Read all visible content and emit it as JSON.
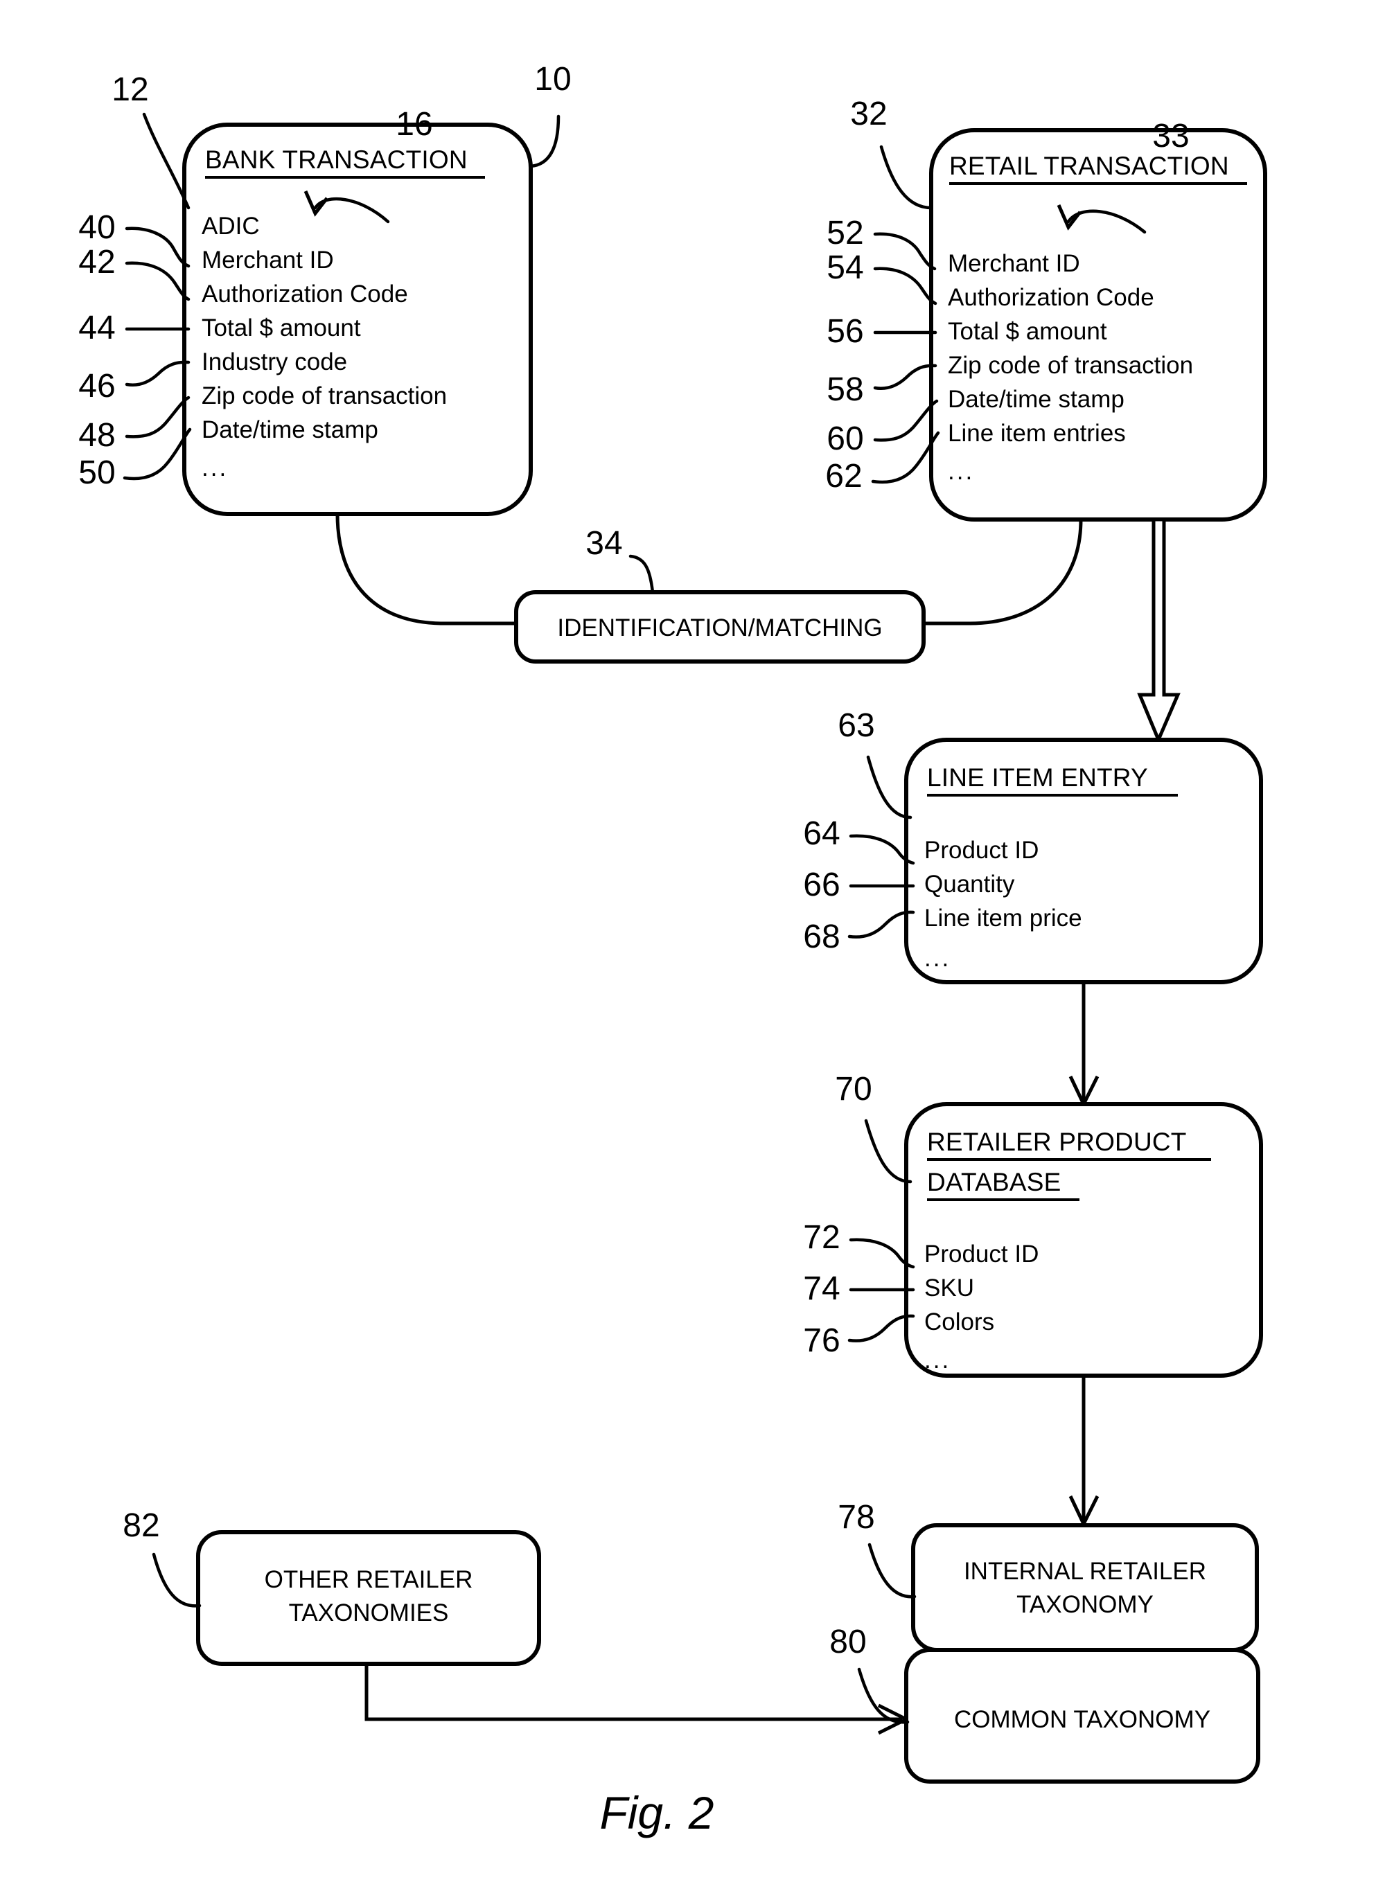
{
  "figure": {
    "caption": "Fig. 2"
  },
  "boxes": {
    "bank_transaction": {
      "ref": "10",
      "title_ref": "12",
      "arrow_ref": "16",
      "title": "BANK TRANSACTION",
      "fields": [
        {
          "ref": "40",
          "label": "ADIC"
        },
        {
          "ref": "42",
          "label": "Merchant ID"
        },
        {
          "ref": "44",
          "label": "Authorization Code"
        },
        {
          "ref": "46",
          "label": "Total $ amount"
        },
        {
          "ref": "48",
          "label": "Industry code"
        },
        {
          "ref": "50",
          "label": "Zip code of transaction"
        },
        {
          "ref": "",
          "label": "Date/time stamp"
        },
        {
          "ref": "",
          "label": "..."
        }
      ],
      "field_refs": [
        "40",
        "42",
        "44",
        "46",
        "48",
        "50"
      ],
      "ellipsis": "..."
    },
    "retail_transaction": {
      "ref": "32",
      "arrow_ref": "33",
      "title": "RETAIL TRANSACTION",
      "fields": [
        {
          "ref": "52",
          "label": "Merchant ID"
        },
        {
          "ref": "54",
          "label": "Authorization Code"
        },
        {
          "ref": "56",
          "label": "Total $ amount"
        },
        {
          "ref": "58",
          "label": "Zip code of transaction"
        },
        {
          "ref": "60",
          "label": "Date/time stamp"
        },
        {
          "ref": "62",
          "label": "Line item entries"
        }
      ],
      "ellipsis": "..."
    },
    "identification_matching": {
      "ref": "34",
      "title": "IDENTIFICATION/MATCHING"
    },
    "line_item_entry": {
      "ref": "63",
      "title": "LINE ITEM ENTRY",
      "fields": [
        {
          "ref": "64",
          "label": "Product ID"
        },
        {
          "ref": "66",
          "label": "Quantity"
        },
        {
          "ref": "68",
          "label": "Line item price"
        }
      ],
      "ellipsis": "..."
    },
    "retailer_product_database": {
      "ref": "70",
      "title_line1": "RETAILER PRODUCT",
      "title_line2": "DATABASE",
      "fields": [
        {
          "ref": "72",
          "label": "Product ID"
        },
        {
          "ref": "74",
          "label": "SKU"
        },
        {
          "ref": "76",
          "label": "Colors"
        }
      ],
      "ellipsis": "..."
    },
    "internal_retailer_taxonomy": {
      "ref": "78",
      "title_line1": "INTERNAL RETAILER",
      "title_line2": "TAXONOMY"
    },
    "other_retailer_taxonomies": {
      "ref": "82",
      "title_line1": "OTHER RETAILER",
      "title_line2": "TAXONOMIES"
    },
    "common_taxonomy": {
      "ref": "80",
      "title": "COMMON TAXONOMY"
    }
  },
  "colors": {
    "ink": "#000000",
    "paper": "#ffffff"
  }
}
